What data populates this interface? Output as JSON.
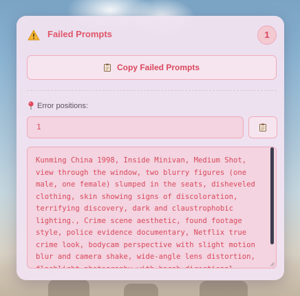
{
  "panel": {
    "title": "Failed Prompts",
    "count": "1",
    "icons": {
      "warning": "warning-icon",
      "clipboard": "clipboard-icon",
      "pin": "pin-icon"
    },
    "copy_button_label": "Copy Failed Prompts",
    "positions_label": "Error positions:",
    "positions_value": "1",
    "prompt_text": "Kunming China 1998, Inside Minivan, Medium Shot, view through the window, two blurry figures (one male, one female) slumped in the seats, disheveled clothing, skin showing signs of discoloration, terrifying discovery, dark and claustrophobic lighting., Crime scene aesthetic, found footage style, police evidence documentary, Netflix true crime look, bodycam perspective with slight motion blur and camera shake, wide-angle lens distortion, flashlight photography with harsh directional",
    "colors": {
      "accent": "#d9485d",
      "panel_bg": "#f0e2f0",
      "field_bg": "#f3d4e0",
      "border": "#efaab8"
    }
  }
}
